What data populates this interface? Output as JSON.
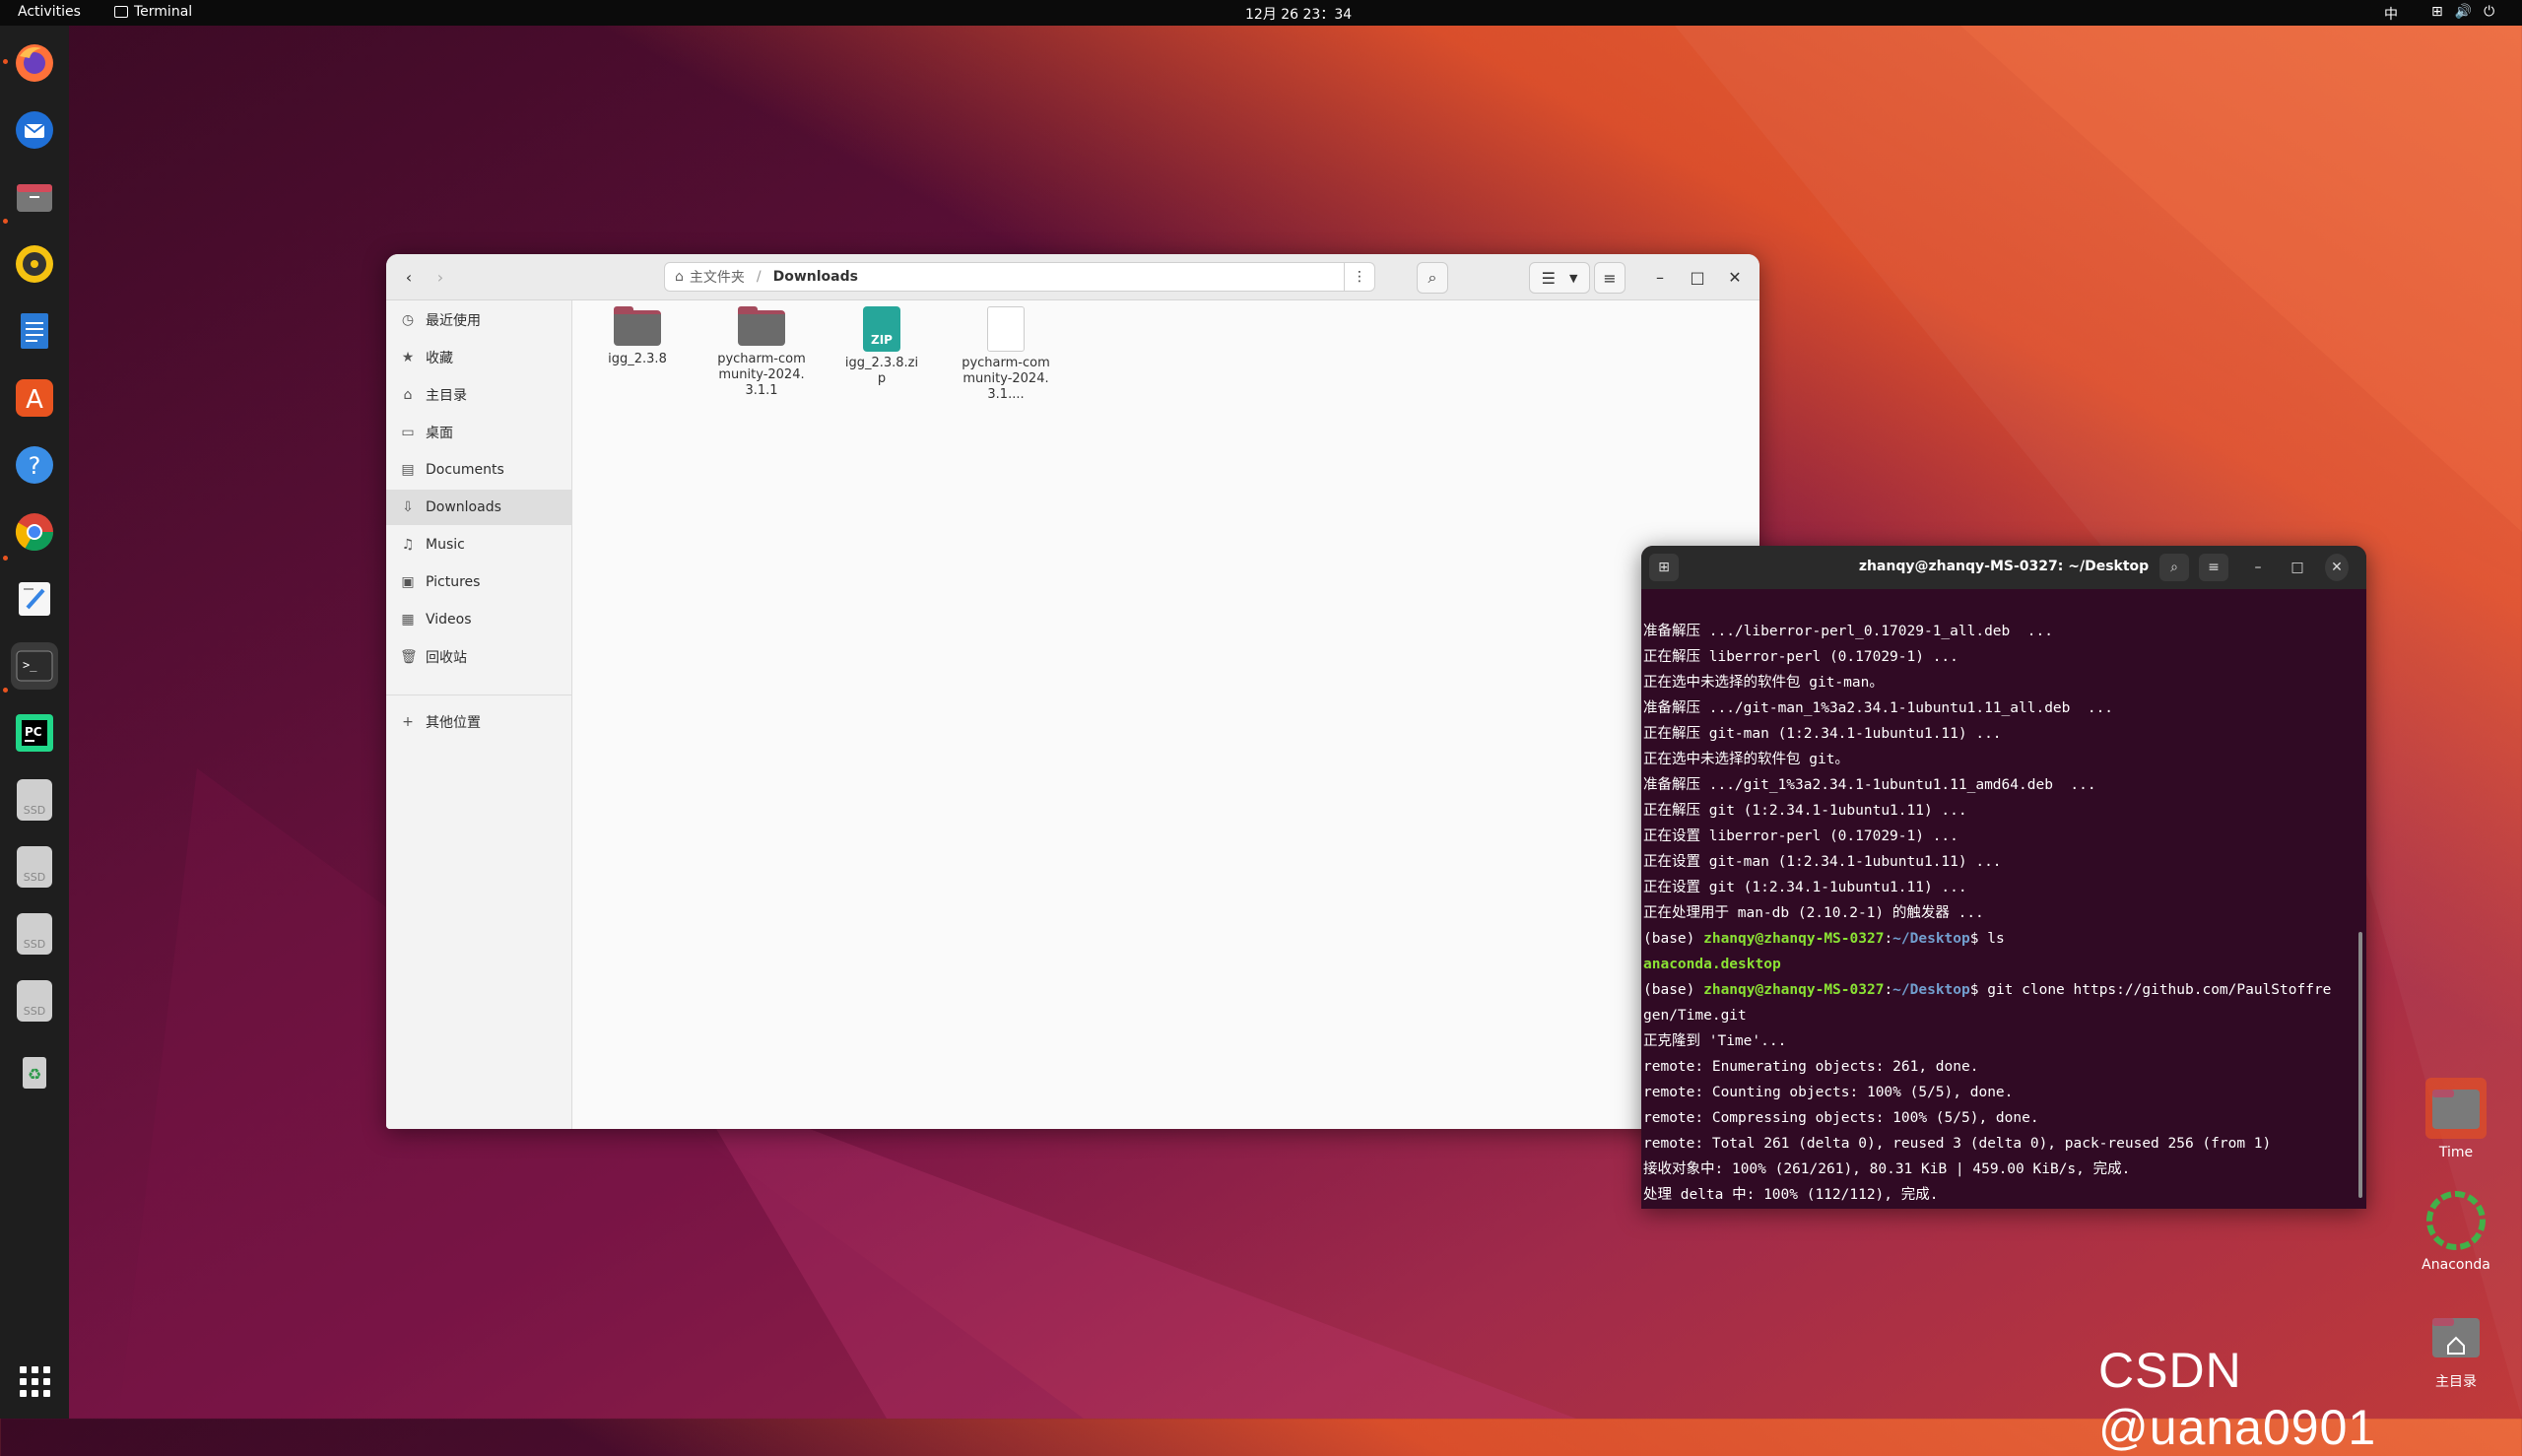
{
  "topbar": {
    "activities": "Activities",
    "app_name": "Terminal",
    "clock": "12月 26 23：34",
    "ime": "中"
  },
  "dock": {
    "items": [
      "firefox-icon",
      "thunderbird-icon",
      "files-icon",
      "rhythmbox-icon",
      "libreoffice-writer-icon",
      "app-center-icon",
      "help-icon",
      "chrome-icon",
      "text-editor-icon",
      "terminal-icon",
      "pycharm-icon",
      "ssd-drive-icon",
      "ssd-drive-icon",
      "ssd-drive-icon",
      "ssd-drive-icon",
      "trash-icon",
      "show-apps-icon"
    ],
    "ssd_label": "SSD"
  },
  "file_manager": {
    "path_home": "主文件夹",
    "path_sep": "/",
    "path_current": "Downloads",
    "sidebar": [
      {
        "icon": "clock-icon",
        "label": "最近使用"
      },
      {
        "icon": "star-icon",
        "label": "收藏"
      },
      {
        "icon": "home-icon",
        "label": "主目录"
      },
      {
        "icon": "desktop-icon",
        "label": "桌面"
      },
      {
        "icon": "document-icon",
        "label": "Documents"
      },
      {
        "icon": "download-icon",
        "label": "Downloads"
      },
      {
        "icon": "music-icon",
        "label": "Music"
      },
      {
        "icon": "picture-icon",
        "label": "Pictures"
      },
      {
        "icon": "video-icon",
        "label": "Videos"
      },
      {
        "icon": "trash-icon",
        "label": "回收站"
      },
      {
        "icon": "plus-icon",
        "label": "其他位置"
      }
    ],
    "files": [
      {
        "name": "igg_2.3.8",
        "type": "folder"
      },
      {
        "name": "pycharm-community-2024.3.1.1",
        "type": "folder"
      },
      {
        "name": "igg_2.3.8.zip",
        "type": "zip"
      },
      {
        "name": "pycharm-community-2024.3.1....",
        "type": "archive"
      }
    ],
    "zip_badge": "ZIP"
  },
  "terminal": {
    "title": "zhanqy@zhanqy-MS-0327: ~/Desktop",
    "lines": [
      "准备解压 .../liberror-perl_0.17029-1_all.deb  ...",
      "正在解压 liberror-perl (0.17029-1) ...",
      "正在选中未选择的软件包 git-man。",
      "准备解压 .../git-man_1%3a2.34.1-1ubuntu1.11_all.deb  ...",
      "正在解压 git-man (1:2.34.1-1ubuntu1.11) ...",
      "正在选中未选择的软件包 git。",
      "准备解压 .../git_1%3a2.34.1-1ubuntu1.11_amd64.deb  ...",
      "正在解压 git (1:2.34.1-1ubuntu1.11) ...",
      "正在设置 liberror-perl (0.17029-1) ...",
      "正在设置 git-man (1:2.34.1-1ubuntu1.11) ...",
      "正在设置 git (1:2.34.1-1ubuntu1.11) ...",
      "正在处理用于 man-db (2.10.2-1) 的触发器 ..."
    ],
    "prompt_base": "(base) ",
    "prompt_user": "zhanqy@zhanqy-MS-0327",
    "prompt_colon": ":",
    "prompt_path": "~/Desktop",
    "prompt_dollar": "$ ",
    "cmd1": "ls",
    "ls_output": "anaconda.desktop",
    "cmd2": "git clone https://github.com/PaulStoffre",
    "cmd2_wrap": "gen/Time.git",
    "clone_lines": [
      "正克隆到 'Time'...",
      "remote: Enumerating objects: 261, done.",
      "remote: Counting objects: 100% (5/5), done.",
      "remote: Compressing objects: 100% (5/5), done.",
      "remote: Total 261 (delta 0), reused 3 (delta 0), pack-reused 256 (from 1)",
      "接收对象中: 100% (261/261), 80.31 KiB | 459.00 KiB/s, 完成.",
      "处理 delta 中: 100% (112/112), 完成."
    ]
  },
  "desktop": {
    "icons": [
      {
        "label": "Time"
      },
      {
        "label": "Anaconda"
      },
      {
        "label": "主目录"
      }
    ],
    "watermark": "CSDN @uana0901"
  }
}
